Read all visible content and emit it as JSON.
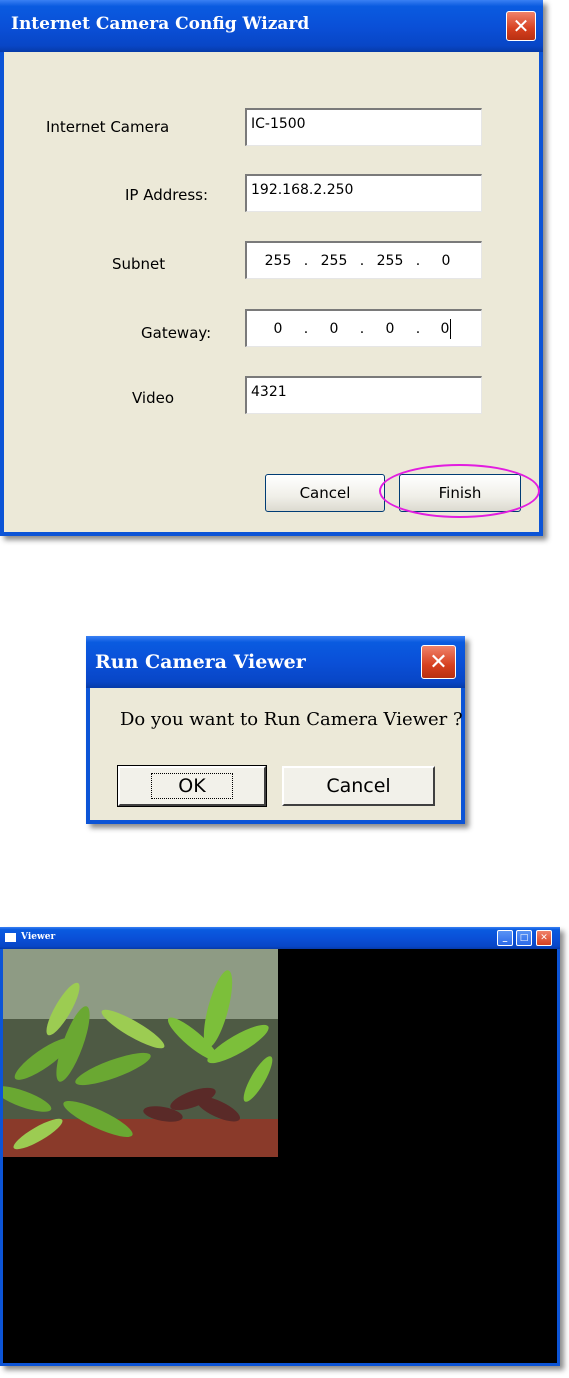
{
  "wizard": {
    "title": "Internet Camera Config Wizard",
    "close_glyph": "✕",
    "fields": {
      "camera_label": "Internet Camera",
      "camera_value": "IC-1500",
      "ip_label": "IP Address:",
      "ip_value": "192.168.2.250",
      "subnet_label": "Subnet",
      "subnet_octets": [
        "255",
        "255",
        "255",
        "0"
      ],
      "gateway_label": "Gateway:",
      "gateway_octets": [
        "0",
        "0",
        "0",
        "0"
      ],
      "video_label": "Video",
      "video_value": "4321"
    },
    "buttons": {
      "cancel": "Cancel",
      "finish": "Finish"
    },
    "highlight_color": "#e21de0"
  },
  "run_viewer": {
    "title": "Run Camera Viewer",
    "close_glyph": "✕",
    "question": "Do you want to Run Camera Viewer ?",
    "buttons": {
      "ok": "OK",
      "cancel": "Cancel"
    }
  },
  "viewer": {
    "title": "Viewer",
    "controls": {
      "minimize": "_",
      "maximize": "□",
      "close": "✕"
    }
  },
  "colors": {
    "xp_blue": "#0a50d8",
    "dialog_face": "#ece9d8",
    "close_red": "#d6401f",
    "video_background": "#000000"
  }
}
